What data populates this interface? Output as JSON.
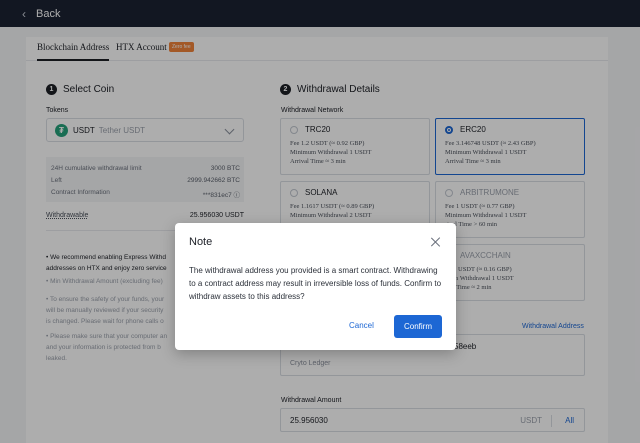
{
  "topbar": {
    "back_label": "Back"
  },
  "tabs": {
    "blockchain": "Blockchain Address",
    "htx": "HTX Account",
    "zero_fee": "Zero fee"
  },
  "step1": {
    "num": "1",
    "title": "Select Coin",
    "tokens_label": "Tokens",
    "token_symbol": "USDT",
    "token_name": "Tether USDT",
    "token_icon": "tether-icon"
  },
  "limits": {
    "rows": [
      {
        "k": "24H cumulative withdrawal limit",
        "v": "3000 BTC"
      },
      {
        "k": "Left",
        "v": "2999.942662 BTC"
      },
      {
        "k": "Contract Information",
        "v": "***831ec7 ⓘ"
      }
    ],
    "withdrawable_label": "Withdrawable",
    "withdrawable_value": "25.956030 USDT"
  },
  "notices": [
    "• We recommend enabling Express Withd",
    "addresses on HTX and enjoy zero service",
    "• Min Withdrawal Amount (excluding fee)",
    "• To ensure the safety of your funds, your",
    "will be manually reviewed if your security",
    "is changed. Please wait for phone calls o",
    "• Please make sure that your computer an",
    "and your information is protected from b",
    "leaked."
  ],
  "step2": {
    "num": "2",
    "title": "Withdrawal Details",
    "network_label": "Withdrawal Network"
  },
  "networks": [
    {
      "name": "TRC20",
      "fee": "Fee 1.2 USDT (≈ 0.92 GBP)",
      "min": "Minimum Withdrawal 1 USDT",
      "time": "Arrival Time ≈ 3 min",
      "selected": false,
      "disabled": false
    },
    {
      "name": "ERC20",
      "fee": "Fee 3.146748 USDT (≈ 2.43 GBP)",
      "min": "Minimum Withdrawal 1 USDT",
      "time": "Arrival Time ≈ 3 min",
      "selected": true,
      "disabled": false
    },
    {
      "name": "SOLANA",
      "fee": "Fee 1.1617 USDT (≈ 0.89 GBP)",
      "min": "Minimum Withdrawal 2 USDT",
      "time": "",
      "selected": false,
      "disabled": false
    },
    {
      "name": "ARBITRUMONE",
      "fee": "Fee 1 USDT (≈ 0.77 GBP)",
      "min": "Minimum Withdrawal 1 USDT",
      "time": "rival Time > 60 min",
      "selected": false,
      "disabled": true
    },
    {
      "name": "AVAXCCHAIN",
      "fee": "0.21 USDT (≈ 0.16 GBP)",
      "min": "mum Withdrawal 1 USDT",
      "time": "ival Time ≈ 2 min",
      "selected": false,
      "disabled": true
    }
  ],
  "address": {
    "link": "Withdrawal Address",
    "value": "58eeb",
    "note": "Cryto Ledger"
  },
  "amount": {
    "label": "Withdrawal Amount",
    "value": "25.956030",
    "unit": "USDT",
    "all": "All"
  },
  "modal": {
    "title": "Note",
    "body": "The withdrawal address you provided is a smart contract. Withdrawing to a contract address may result in irreversible loss of funds. Confirm to withdraw assets to this address?",
    "cancel": "Cancel",
    "confirm": "Confirm"
  },
  "colors": {
    "accent": "#1d67d4",
    "topbar": "#1b2333",
    "badge": "#f0833a",
    "tether": "#26a17b"
  }
}
